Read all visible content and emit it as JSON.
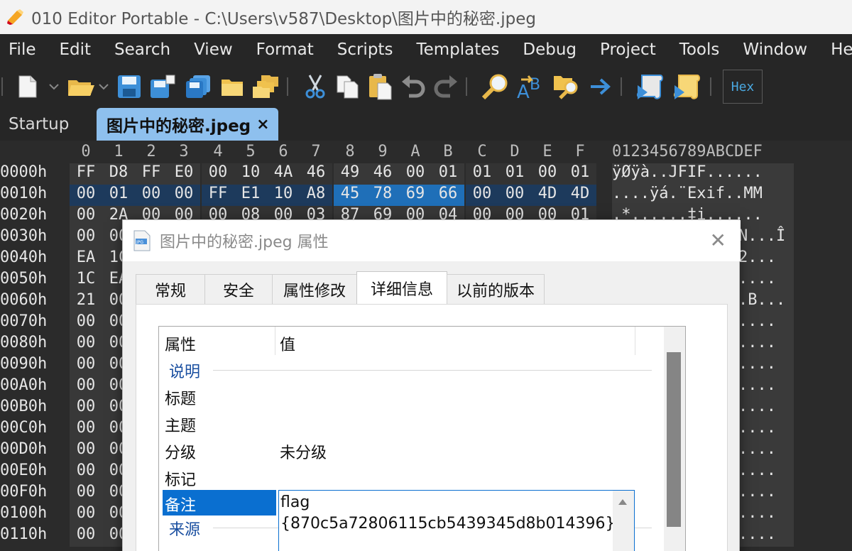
{
  "window": {
    "title": "010 Editor Portable - C:\\Users\\v587\\Desktop\\图片中的秘密.jpeg"
  },
  "menu": {
    "items": [
      "File",
      "Edit",
      "Search",
      "View",
      "Format",
      "Scripts",
      "Templates",
      "Debug",
      "Project",
      "Tools",
      "Window",
      "Help"
    ]
  },
  "toolbar": {
    "icons": [
      "new-file-icon",
      "open-folder-icon",
      "save-icon",
      "save-as-icon",
      "save-all-icon",
      "folder-icon",
      "workspace-icon",
      "cut-icon",
      "copy-icon",
      "paste-icon",
      "undo-icon",
      "redo-icon",
      "find-icon",
      "replace-icon",
      "find-in-files-icon",
      "goto-icon",
      "run-script-icon",
      "run-template-icon"
    ],
    "hex_label": "Hex"
  },
  "tabs": {
    "startup": "Startup",
    "active": "图片中的秘密.jpeg",
    "close": "×"
  },
  "hex": {
    "col_labels": [
      "0",
      "1",
      "2",
      "3",
      "4",
      "5",
      "6",
      "7",
      "8",
      "9",
      "A",
      "B",
      "C",
      "D",
      "E",
      "F"
    ],
    "ascii_header": "0123456789ABCDEF",
    "rows": [
      {
        "addr": "0000h",
        "bytes": [
          "FF",
          "D8",
          "FF",
          "E0",
          "00",
          "10",
          "4A",
          "46",
          "49",
          "46",
          "00",
          "01",
          "01",
          "01",
          "00",
          "01"
        ],
        "ascii": "ÿØÿà..JFIF......"
      },
      {
        "addr": "0010h",
        "bytes": [
          "00",
          "01",
          "00",
          "00",
          "FF",
          "E1",
          "10",
          "A8",
          "45",
          "78",
          "69",
          "66",
          "00",
          "00",
          "4D",
          "4D"
        ],
        "ascii": "....ÿá.¨Exif..MM"
      },
      {
        "addr": "0020h",
        "bytes": [
          "00",
          "2A",
          "00",
          "00",
          "00",
          "08",
          "00",
          "03",
          "87",
          "69",
          "00",
          "04",
          "00",
          "00",
          "00",
          "01"
        ],
        "ascii": ".*......‡i......"
      },
      {
        "addr": "0030h",
        "bytes": [
          "00",
          "00"
        ],
        "ascii": "N...Î"
      },
      {
        "addr": "0040h",
        "bytes": [
          "EA",
          "1C"
        ],
        "ascii": "2..."
      },
      {
        "addr": "0050h",
        "bytes": [
          "1C",
          "EA"
        ],
        "ascii": "...."
      },
      {
        "addr": "0060h",
        "bytes": [
          "21",
          "00"
        ],
        "ascii": ".B..."
      },
      {
        "addr": "0070h",
        "bytes": [
          "00",
          "00"
        ],
        "ascii": "...."
      },
      {
        "addr": "0080h",
        "bytes": [
          "00",
          "00"
        ],
        "ascii": "...."
      },
      {
        "addr": "0090h",
        "bytes": [
          "00",
          "00"
        ],
        "ascii": "...."
      },
      {
        "addr": "00A0h",
        "bytes": [
          "00",
          "00"
        ],
        "ascii": "...."
      },
      {
        "addr": "00B0h",
        "bytes": [
          "00",
          "00"
        ],
        "ascii": "...."
      },
      {
        "addr": "00C0h",
        "bytes": [
          "00",
          "00"
        ],
        "ascii": "...."
      },
      {
        "addr": "00D0h",
        "bytes": [
          "00",
          "00"
        ],
        "ascii": "...."
      },
      {
        "addr": "00E0h",
        "bytes": [
          "00",
          "00"
        ],
        "ascii": "...."
      },
      {
        "addr": "00F0h",
        "bytes": [
          "00",
          "00"
        ],
        "ascii": "...."
      },
      {
        "addr": "0100h",
        "bytes": [
          "00",
          "00"
        ],
        "ascii": "...."
      },
      {
        "addr": "0110h",
        "bytes": [
          "00",
          "00"
        ],
        "ascii": "...."
      }
    ]
  },
  "dialog": {
    "title": "图片中的秘密.jpeg 属性",
    "close": "✕",
    "tabs": [
      "常规",
      "安全",
      "属性修改",
      "详细信息",
      "以前的版本"
    ],
    "active_tab": "详细信息",
    "list": {
      "col_name": "属性",
      "col_value": "值",
      "group_description": "说明",
      "rows": [
        {
          "name": "标题",
          "value": ""
        },
        {
          "name": "主题",
          "value": ""
        },
        {
          "name": "分级",
          "value": "未分级"
        },
        {
          "name": "标记",
          "value": ""
        },
        {
          "name": "备注",
          "value": "flag {870c5a72806115cb5439345d8b014396}"
        }
      ],
      "group_source": "来源"
    }
  },
  "colors": {
    "accent": "#0a6fd0",
    "hex_selection": "#1f6fb8",
    "active_tab": "#8ec0ee"
  }
}
